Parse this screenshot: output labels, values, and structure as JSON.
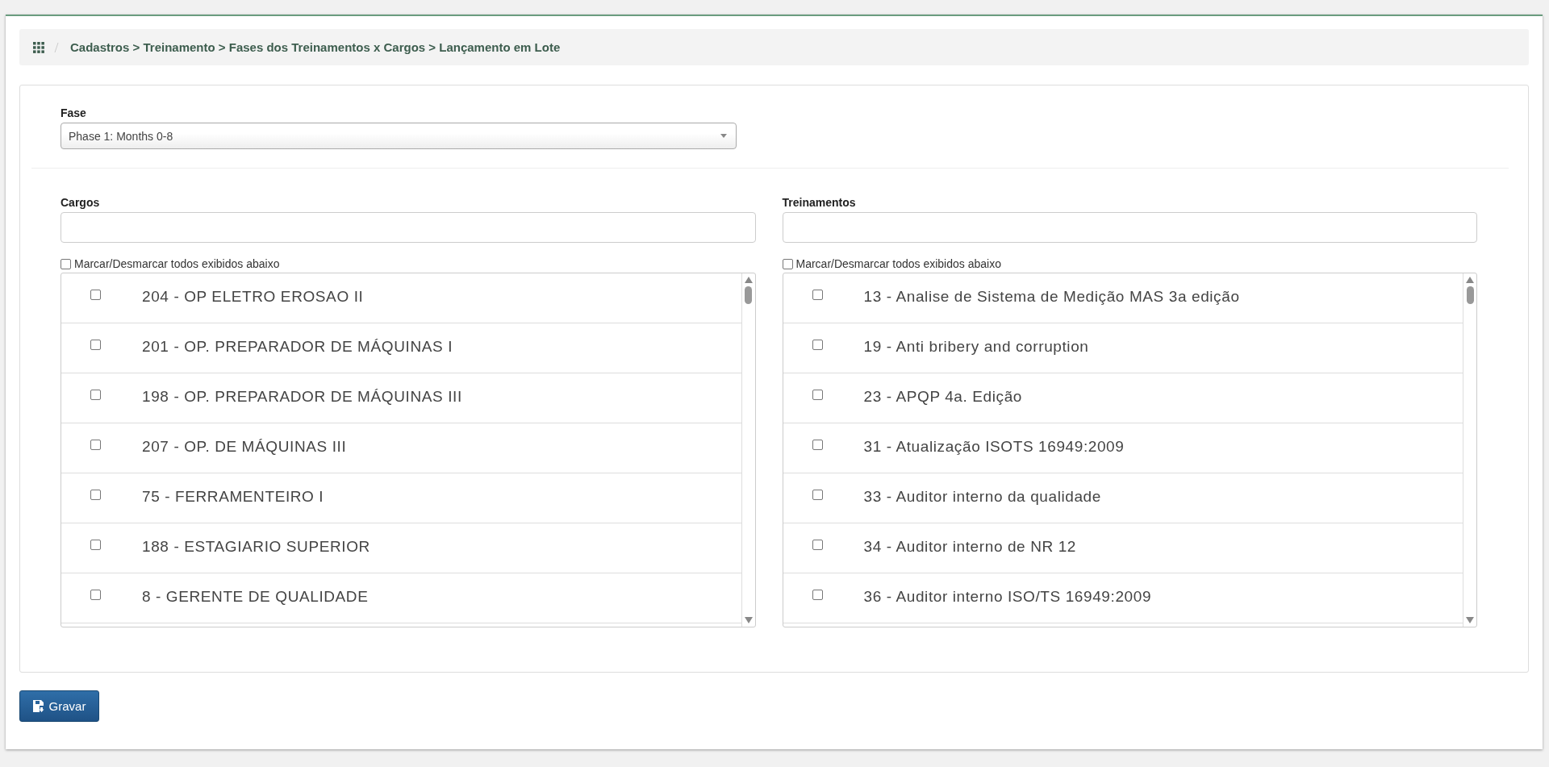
{
  "breadcrumb": "Cadastros > Treinamento > Fases dos Treinamentos x Cargos > Lançamento em Lote",
  "fase": {
    "label": "Fase",
    "value": "Phase 1: Months 0-8"
  },
  "lists": [
    {
      "label": "Cargos",
      "check_all": {
        "label": "Marcar/Desmarcar todos exibidos abaixo",
        "checked": false
      },
      "items": [
        {
          "label": "204 - OP ELETRO EROSAO II",
          "checked": false
        },
        {
          "label": "201 - OP. PREPARADOR DE MÁQUINAS I",
          "checked": false
        },
        {
          "label": "198 - OP. PREPARADOR DE MÁQUINAS III",
          "checked": false
        },
        {
          "label": "207 - OP. DE MÁQUINAS III",
          "checked": false
        },
        {
          "label": "75 - FERRAMENTEIRO I",
          "checked": false
        },
        {
          "label": "188 - ESTAGIARIO SUPERIOR",
          "checked": false
        },
        {
          "label": "8 - GERENTE DE QUALIDADE",
          "checked": false
        }
      ]
    },
    {
      "label": "Treinamentos",
      "check_all": {
        "label": "Marcar/Desmarcar todos exibidos abaixo",
        "checked": false
      },
      "items": [
        {
          "label": "13 - Analise de Sistema de Medição MAS 3a edição",
          "checked": false
        },
        {
          "label": "19 - Anti bribery and corruption",
          "checked": false
        },
        {
          "label": "23 - APQP 4a. Edição",
          "checked": false
        },
        {
          "label": "31 - Atualização ISOTS 16949:2009",
          "checked": false
        },
        {
          "label": "33 - Auditor interno da qualidade",
          "checked": false
        },
        {
          "label": "34 - Auditor interno de NR 12",
          "checked": false
        },
        {
          "label": "36 - Auditor interno ISO/TS 16949:2009",
          "checked": false
        }
      ]
    }
  ],
  "save_button": "Gravar"
}
